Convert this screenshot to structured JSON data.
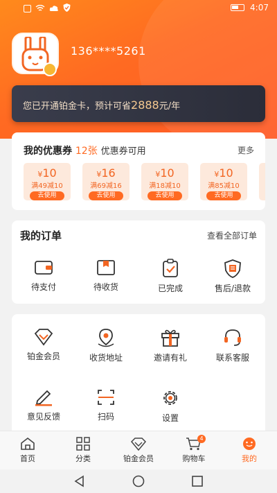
{
  "status_bar": {
    "time": "4:07"
  },
  "profile": {
    "phone": "136****5261"
  },
  "vip_card": {
    "prefix": "您已开通铂金卡，预计可省",
    "amount": "2888",
    "suffix": "元/年"
  },
  "coupons": {
    "title": "我的优惠券",
    "count": "12张",
    "subtitle": "优惠券可用",
    "more": "更多",
    "items": [
      {
        "currency": "¥",
        "amount": "10",
        "condition": "满49减10",
        "action": "去使用"
      },
      {
        "currency": "¥",
        "amount": "16",
        "condition": "满69减16",
        "action": "去使用"
      },
      {
        "currency": "¥",
        "amount": "10",
        "condition": "满18减10",
        "action": "去使用"
      },
      {
        "currency": "¥",
        "amount": "10",
        "condition": "满85减10",
        "action": "去使用"
      }
    ]
  },
  "orders": {
    "title": "我的订单",
    "view_all": "查看全部订单",
    "items": [
      {
        "label": "待支付",
        "icon": "wallet-icon"
      },
      {
        "label": "待收货",
        "icon": "package-icon"
      },
      {
        "label": "已完成",
        "icon": "clipboard-check-icon"
      },
      {
        "label": "售后/退款",
        "icon": "shield-receipt-icon"
      }
    ]
  },
  "tools": {
    "items": [
      {
        "label": "铂金会员",
        "icon": "diamond-icon"
      },
      {
        "label": "收货地址",
        "icon": "location-icon"
      },
      {
        "label": "邀请有礼",
        "icon": "gift-icon"
      },
      {
        "label": "联系客服",
        "icon": "headset-icon"
      },
      {
        "label": "意见反馈",
        "icon": "pencil-icon"
      },
      {
        "label": "扫码",
        "icon": "scan-icon"
      },
      {
        "label": "设置",
        "icon": "gear-icon"
      }
    ]
  },
  "tabbar": {
    "items": [
      {
        "label": "首页",
        "icon": "home-icon"
      },
      {
        "label": "分类",
        "icon": "category-icon"
      },
      {
        "label": "铂金会员",
        "icon": "diamond-icon"
      },
      {
        "label": "购物车",
        "icon": "cart-icon",
        "badge": "4"
      },
      {
        "label": "我的",
        "icon": "face-icon",
        "active": true
      }
    ]
  },
  "colors": {
    "accent": "#ff6a22",
    "card_dark": "#2b2d39",
    "gold": "#f5c990"
  }
}
